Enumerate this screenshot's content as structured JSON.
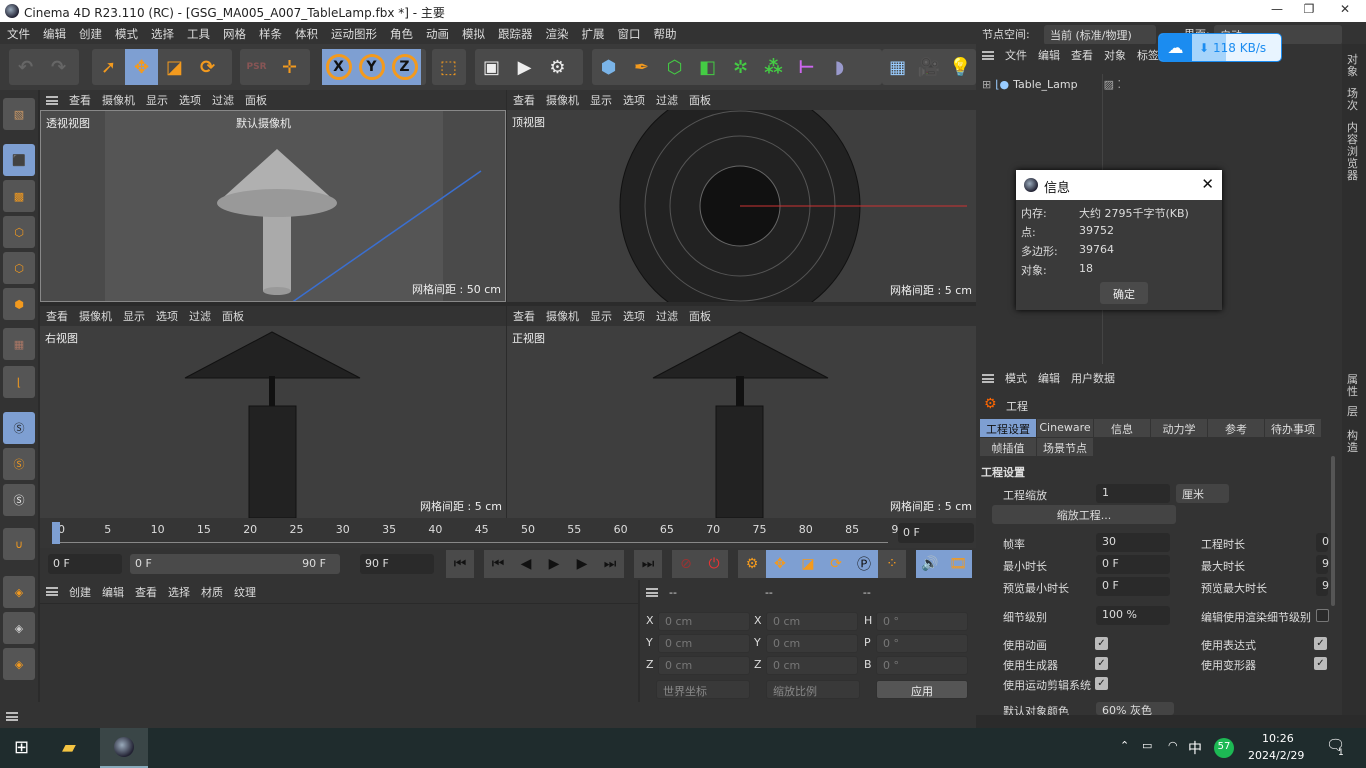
{
  "window": {
    "title": "Cinema 4D R23.110 (RC) - [GSG_MA005_A007_TableLamp.fbx *] - 主要",
    "controls": [
      "—",
      "❐",
      "✕"
    ]
  },
  "menu": [
    "文件",
    "编辑",
    "创建",
    "模式",
    "选择",
    "工具",
    "网格",
    "样条",
    "体积",
    "运动图形",
    "角色",
    "动画",
    "模拟",
    "跟踪器",
    "渲染",
    "扩展",
    "窗口",
    "帮助"
  ],
  "node_space": {
    "label": "节点空间:",
    "value": "当前 (标准/物理)",
    "layout_label": "界面:",
    "layout_value": "启动"
  },
  "download_widget": {
    "speed": "118 KB/s",
    "accent": "#1b8cf0"
  },
  "toolbar": {
    "axis": [
      "X",
      "Y",
      "Z"
    ]
  },
  "viewport_menu": [
    "查看",
    "摄像机",
    "显示",
    "选项",
    "过滤",
    "面板"
  ],
  "viewports": [
    {
      "name": "透视视图",
      "camera": "默认摄像机",
      "grid": "网格间距 : 50 cm"
    },
    {
      "name": "顶视图",
      "grid": "网格间距 : 5 cm"
    },
    {
      "name": "右视图",
      "grid": "网格间距 : 5 cm"
    },
    {
      "name": "正视图",
      "grid": "网格间距 : 5 cm"
    }
  ],
  "timeline": {
    "ticks": [
      "0",
      "5",
      "10",
      "15",
      "20",
      "25",
      "30",
      "35",
      "40",
      "45",
      "50",
      "55",
      "60",
      "65",
      "70",
      "75",
      "80",
      "85",
      "90"
    ],
    "current_frame": "0 F",
    "start": "0 F",
    "range_start": "0 F",
    "range_end": "90 F",
    "end": "90 F"
  },
  "material_panel": {
    "menu": [
      "创建",
      "编辑",
      "查看",
      "选择",
      "材质",
      "纹理"
    ]
  },
  "coord_panel": {
    "headers": [
      "--",
      "--",
      "--"
    ],
    "rows": [
      {
        "a": "X",
        "av": "0 cm",
        "b": "X",
        "bv": "0 cm",
        "c": "H",
        "cv": "0 °"
      },
      {
        "a": "Y",
        "av": "0 cm",
        "b": "Y",
        "bv": "0 cm",
        "c": "P",
        "cv": "0 °"
      },
      {
        "a": "Z",
        "av": "0 cm",
        "b": "Z",
        "bv": "0 cm",
        "c": "B",
        "cv": "0 °"
      }
    ],
    "coord_mode": "世界坐标",
    "scale_mode": "缩放比例",
    "apply": "应用"
  },
  "object_manager": {
    "menu": [
      "文件",
      "编辑",
      "查看",
      "对象",
      "标签",
      "书签"
    ],
    "objects": [
      {
        "name": "Table_Lamp"
      }
    ]
  },
  "side_tabs": [
    "对象",
    "场次",
    "内容浏览器",
    "属性",
    "层",
    "构造"
  ],
  "info_dialog": {
    "title": "信息",
    "rows": [
      {
        "label": "内存:",
        "value": "大约 2795千字节(KB)"
      },
      {
        "label": "点:",
        "value": "39752"
      },
      {
        "label": "多边形:",
        "value": "39764"
      },
      {
        "label": "对象:",
        "value": "18"
      }
    ],
    "ok": "确定"
  },
  "attributes": {
    "menu": [
      "模式",
      "编辑",
      "用户数据"
    ],
    "object": "工程",
    "tabs": [
      "工程设置",
      "Cineware",
      "信息",
      "动力学",
      "参考",
      "待办事项",
      "帧插值",
      "场景节点"
    ],
    "section": "工程设置",
    "scale_label": "工程缩放",
    "scale_value": "1",
    "scale_unit": "厘米",
    "scale_button": "缩放工程...",
    "fps_label": "帧率",
    "fps": "30",
    "project_time_label": "工程时长",
    "project_time": "0",
    "min_time_label": "最小时长",
    "min_time": "0 F",
    "max_time_label": "最大时长",
    "max_time": "9",
    "preview_min_label": "预览最小时长",
    "preview_min": "0 F",
    "preview_max_label": "预览最大时长",
    "preview_max": "9",
    "lod_label": "细节级别",
    "lod": "100 %",
    "render_lod_label": "编辑使用渲染细节级别",
    "checks": [
      {
        "label": "使用动画",
        "checked": true
      },
      {
        "label": "使用表达式",
        "checked": true
      },
      {
        "label": "使用生成器",
        "checked": true
      },
      {
        "label": "使用变形器",
        "checked": true
      },
      {
        "label": "使用运动剪辑系统",
        "checked": true
      }
    ],
    "default_color_label": "默认对象颜色",
    "default_color": "60% 灰色"
  },
  "taskbar": {
    "ime": "中",
    "badge": "57",
    "time": "10:26",
    "date": "2024/2/29",
    "notifications": "1"
  }
}
